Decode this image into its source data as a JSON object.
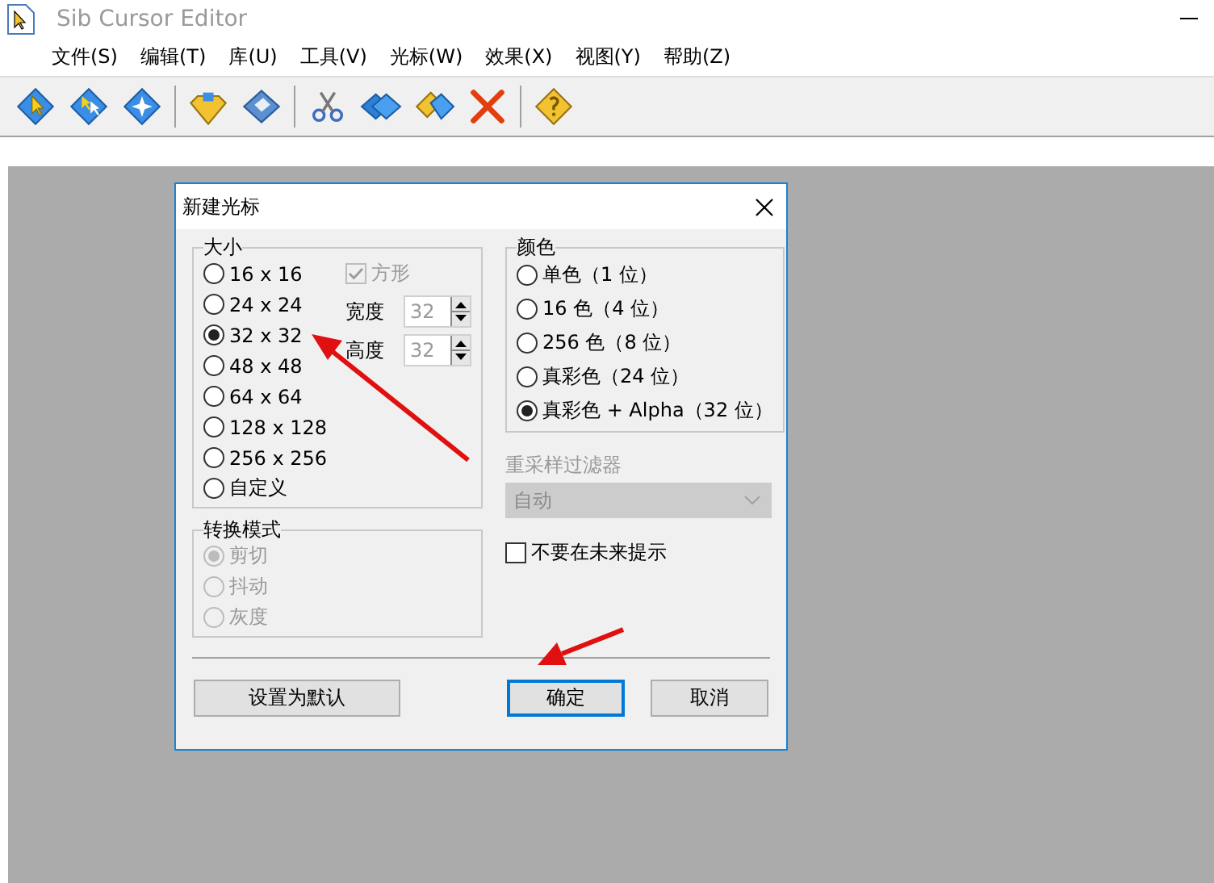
{
  "window": {
    "title": "Sib Cursor Editor"
  },
  "menu": [
    {
      "label": "文件(S)"
    },
    {
      "label": "编辑(T)"
    },
    {
      "label": "库(U)"
    },
    {
      "label": "工具(V)"
    },
    {
      "label": "光标(W)"
    },
    {
      "label": "效果(X)"
    },
    {
      "label": "视图(Y)"
    },
    {
      "label": "帮助(Z)"
    }
  ],
  "dialog": {
    "title": "新建光标",
    "size": {
      "legend": "大小",
      "options": [
        {
          "label": "16 x 16",
          "selected": false
        },
        {
          "label": "24 x 24",
          "selected": false
        },
        {
          "label": "32 x 32",
          "selected": true
        },
        {
          "label": "48 x 48",
          "selected": false
        },
        {
          "label": "64 x 64",
          "selected": false
        },
        {
          "label": "128 x 128",
          "selected": false
        },
        {
          "label": "256 x 256",
          "selected": false
        },
        {
          "label": "自定义",
          "selected": false
        }
      ],
      "square": {
        "label": "方形",
        "checked": true,
        "disabled": true
      },
      "width": {
        "label": "宽度",
        "value": "32",
        "disabled": true
      },
      "height": {
        "label": "高度",
        "value": "32",
        "disabled": true
      }
    },
    "color": {
      "legend": "颜色",
      "options": [
        {
          "label": "单色（1 位）",
          "selected": false
        },
        {
          "label": "16 色（4 位）",
          "selected": false
        },
        {
          "label": "256 色（8 位）",
          "selected": false
        },
        {
          "label": "真彩色（24 位）",
          "selected": false
        },
        {
          "label": "真彩色 + Alpha（32 位）",
          "selected": true
        }
      ]
    },
    "filter": {
      "label": "重采样过滤器",
      "value": "自动",
      "disabled": true
    },
    "conversion": {
      "legend": "转换模式",
      "disabled": true,
      "options": [
        {
          "label": "剪切",
          "selected": true
        },
        {
          "label": "抖动",
          "selected": false
        },
        {
          "label": "灰度",
          "selected": false
        }
      ]
    },
    "dont_show": {
      "label": "不要在未来提示",
      "checked": false
    },
    "buttons": [
      {
        "label": "设置为默认",
        "default": false
      },
      {
        "label": "确定",
        "default": true
      },
      {
        "label": "取消",
        "default": false
      }
    ]
  }
}
